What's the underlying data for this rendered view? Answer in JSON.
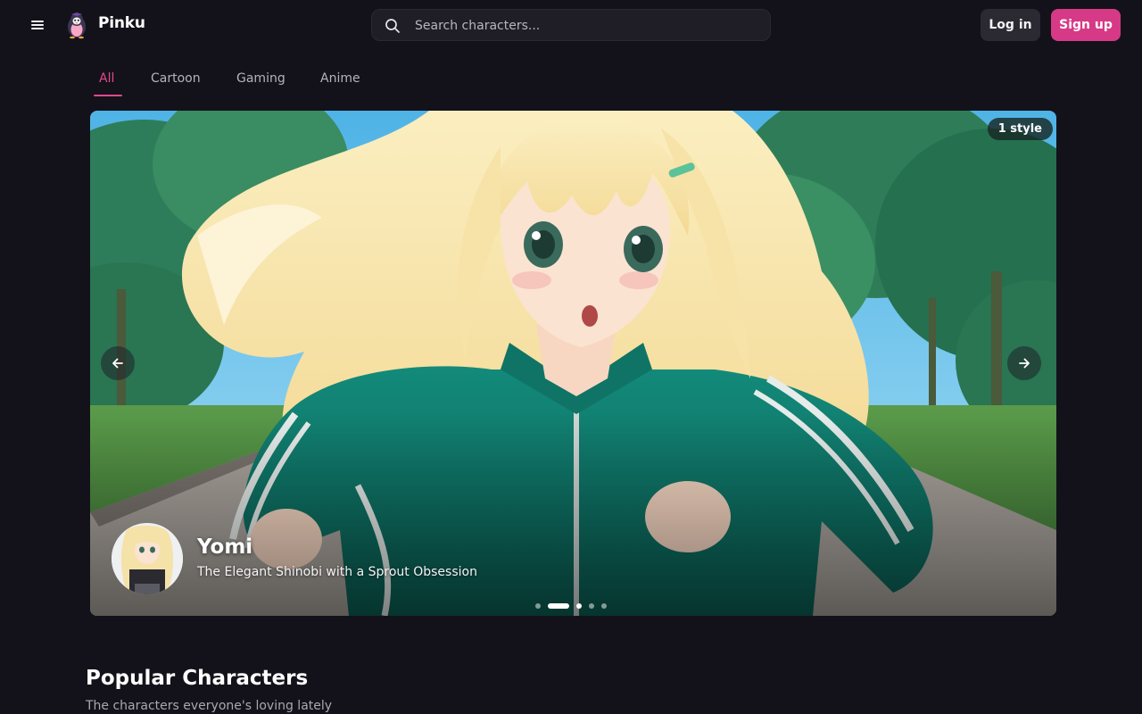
{
  "header": {
    "brand": "Pinku",
    "search_placeholder": "Search characters...",
    "login_label": "Log in",
    "signup_label": "Sign up"
  },
  "tabs": [
    {
      "label": "All",
      "active": true
    },
    {
      "label": "Cartoon",
      "active": false
    },
    {
      "label": "Gaming",
      "active": false
    },
    {
      "label": "Anime",
      "active": false
    }
  ],
  "hero": {
    "styles_badge": "1 style",
    "character_name": "Yomi",
    "character_tagline": "The Elegant Shinobi with a Sprout Obsession",
    "active_slide": 2,
    "slide_count": 5
  },
  "popular": {
    "title": "Popular Characters",
    "subtitle": "The characters everyone's loving lately"
  },
  "colors": {
    "background": "#13121a",
    "accent": "#e2498f",
    "signup": "#d63a86",
    "surface": "#1f1e27"
  },
  "icons": [
    "menu-icon",
    "penguin-logo-icon",
    "search-icon",
    "arrow-left-icon",
    "arrow-right-icon"
  ]
}
